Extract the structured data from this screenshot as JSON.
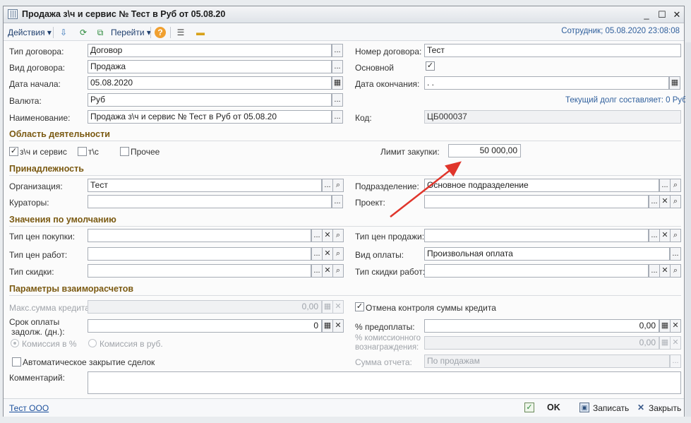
{
  "window": {
    "title": "Продажа з\\ч и сервис № Тест в Руб от 05.08.20",
    "minimize": "_",
    "maximize": "☐",
    "close": "✕"
  },
  "toolbar": {
    "actions": "Действия",
    "goto": "Перейти",
    "employee": "Сотрудник; 05.08.2020 23:08:08",
    "help": "?"
  },
  "form": {
    "contract_type": {
      "label": "Тип договора:",
      "value": "Договор"
    },
    "contract_kind": {
      "label": "Вид договора:",
      "value": "Продажа"
    },
    "start_date": {
      "label": "Дата начала:",
      "value": "05.08.2020"
    },
    "currency": {
      "label": "Валюта:",
      "value": "Руб"
    },
    "name": {
      "label": "Наименование:",
      "value": "Продажа з\\ч и сервис № Тест в Руб от 05.08.20"
    },
    "contract_number": {
      "label": "Номер договора:",
      "value": "Тест"
    },
    "main": {
      "label": "Основной",
      "checked": true
    },
    "end_date": {
      "label": "Дата окончания:",
      "value": " .  ."
    },
    "current_debt": "Текущий долг составляет: 0 Руб",
    "code": {
      "label": "Код:",
      "value": "ЦБ000037"
    }
  },
  "activity": {
    "title": "Область деятельности",
    "spare_parts": {
      "label": "з\\ч и сервис",
      "checked": true
    },
    "vehicles": {
      "label": "т\\с",
      "checked": false
    },
    "other": {
      "label": "Прочее",
      "checked": false
    },
    "purchase_limit": {
      "label": "Лимит закупки:",
      "value": "50 000,00"
    }
  },
  "belonging": {
    "title": "Принадлежность",
    "organization": {
      "label": "Организация:",
      "value": "Тест"
    },
    "curators": {
      "label": "Кураторы:",
      "value": ""
    },
    "department": {
      "label": "Подразделение:",
      "value": "Основное подразделение"
    },
    "project": {
      "label": "Проект:",
      "value": ""
    }
  },
  "defaults": {
    "title": "Значения по умолчанию",
    "purchase_price_type": {
      "label": "Тип цен покупки:",
      "value": ""
    },
    "work_price_type": {
      "label": "Тип цен работ:",
      "value": ""
    },
    "discount_type": {
      "label": "Тип скидки:",
      "value": ""
    },
    "sale_price_type": {
      "label": "Тип цен продажи:",
      "value": ""
    },
    "payment_type": {
      "label": "Вид оплаты:",
      "value": "Произвольная оплата"
    },
    "work_discount_type": {
      "label": "Тип скидки работ:",
      "value": ""
    }
  },
  "settlements": {
    "title": "Параметры взаиморасчетов",
    "max_credit": {
      "label": "Макс.сумма кредита:",
      "value": "0,00"
    },
    "cancel_credit_control": {
      "label": "Отмена контроля суммы кредита",
      "checked": true
    },
    "payment_term": {
      "label1": "Срок оплаты",
      "label2": "задолж. (дн.):",
      "value": "0"
    },
    "prepayment": {
      "label": "% предоплаты:",
      "value": "0,00"
    },
    "commission_percent": {
      "label": "Комиссия в %"
    },
    "commission_rub": {
      "label": "Комиссия в руб."
    },
    "commission_reward": {
      "label1": "% комиссионного",
      "label2": "вознаграждения:",
      "value": "0,00"
    },
    "auto_close": {
      "label": "Автоматическое закрытие сделок",
      "checked": false
    },
    "report_sum": {
      "label": "Сумма отчета:",
      "value": "По продажам"
    },
    "comment": {
      "label": "Комментарий:",
      "value": ""
    }
  },
  "footer": {
    "org_link": "Тест ООО",
    "ok": "OK",
    "save": "Записать",
    "close": "Закрыть"
  },
  "colors": {
    "section": "#7b5a12",
    "link": "#2f5f9c",
    "arrow": "#e0352b"
  }
}
